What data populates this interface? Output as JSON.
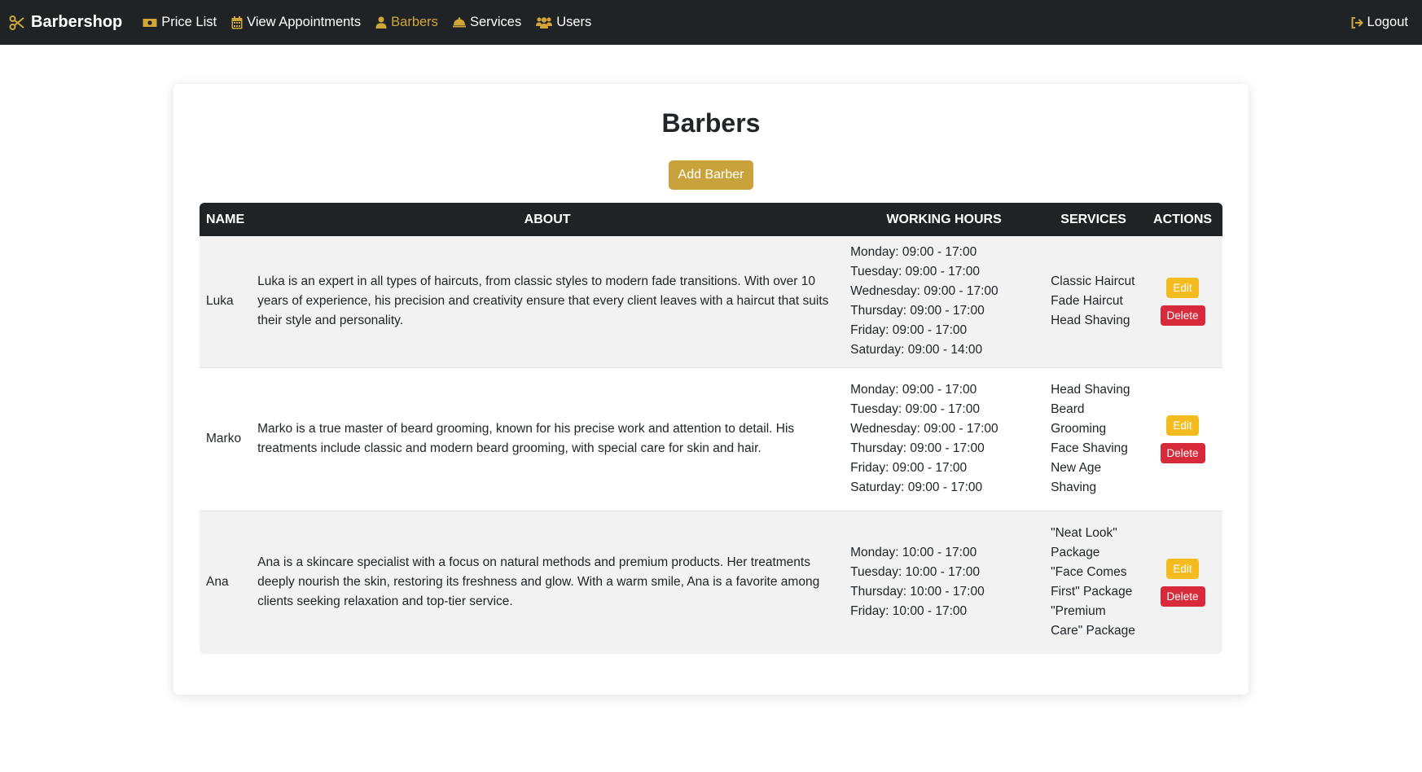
{
  "nav": {
    "brand": "Barbershop",
    "items": [
      {
        "label": "Price List",
        "icon": "money-icon"
      },
      {
        "label": "View Appointments",
        "icon": "calendar-icon"
      },
      {
        "label": "Barbers",
        "icon": "user-icon",
        "active": true
      },
      {
        "label": "Services",
        "icon": "bell-icon"
      },
      {
        "label": "Users",
        "icon": "users-icon"
      }
    ],
    "logout": "Logout"
  },
  "colors": {
    "navbar": "#1f2326",
    "accent": "#d1a637",
    "add_button": "#c9a23c",
    "edit_button": "#f5bc1f",
    "delete_button": "#d72a3a"
  },
  "page": {
    "title": "Barbers",
    "add_button": "Add Barber"
  },
  "table": {
    "headers": [
      "NAME",
      "ABOUT",
      "WORKING HOURS",
      "SERVICES",
      "ACTIONS"
    ],
    "rows": [
      {
        "name": "Luka",
        "about": "Luka is an expert in all types of haircuts, from classic styles to modern fade transitions. With over 10 years of experience, his precision and creativity ensure that every client leaves with a haircut that suits their style and personality.",
        "hours": [
          "Monday: 09:00 - 17:00",
          "Tuesday: 09:00 - 17:00",
          "Wednesday: 09:00 - 17:00",
          "Thursday: 09:00 - 17:00",
          "Friday: 09:00 - 17:00",
          "Saturday: 09:00 - 14:00"
        ],
        "services": [
          "Classic Haircut",
          "Fade Haircut",
          "Head Shaving"
        ],
        "edit": "Edit",
        "delete": "Delete"
      },
      {
        "name": "Marko",
        "about": "Marko is a true master of beard grooming, known for his precise work and attention to detail. His treatments include classic and modern beard grooming, with special care for skin and hair.",
        "hours": [
          "Monday: 09:00 - 17:00",
          "Tuesday: 09:00 - 17:00",
          "Wednesday: 09:00 - 17:00",
          "Thursday: 09:00 - 17:00",
          "Friday: 09:00 - 17:00",
          "Saturday: 09:00 - 17:00"
        ],
        "services": [
          "Head Shaving",
          "Beard Grooming",
          "Face Shaving",
          "New Age Shaving"
        ],
        "edit": "Edit",
        "delete": "Delete"
      },
      {
        "name": "Ana",
        "about": "Ana is a skincare specialist with a focus on natural methods and premium products. Her treatments deeply nourish the skin, restoring its freshness and glow. With a warm smile, Ana is a favorite among clients seeking relaxation and top-tier service.",
        "hours": [
          "Monday: 10:00 - 17:00",
          "Tuesday: 10:00 - 17:00",
          "Thursday: 10:00 - 17:00",
          "Friday: 10:00 - 17:00"
        ],
        "services": [
          "\"Neat Look\" Package",
          "\"Face Comes First\" Package",
          "\"Premium Care\" Package"
        ],
        "edit": "Edit",
        "delete": "Delete"
      }
    ]
  }
}
